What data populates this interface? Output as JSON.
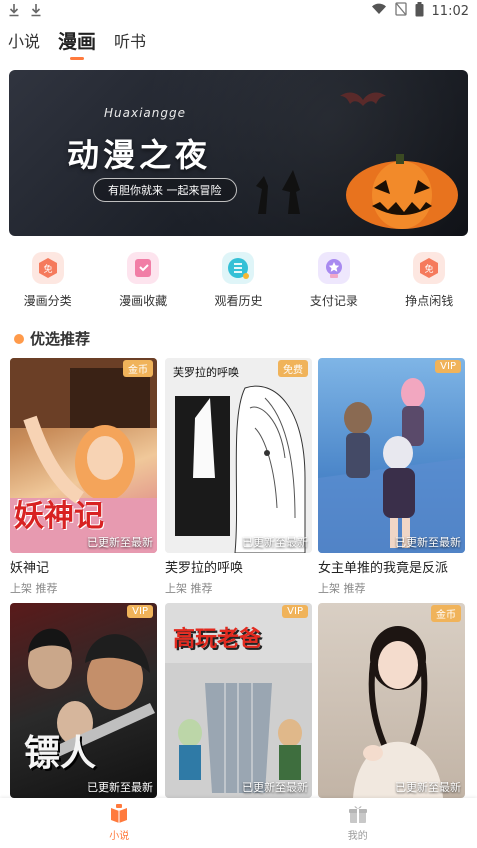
{
  "status_bar": {
    "time": "11:02"
  },
  "tabs": [
    {
      "label": "小说"
    },
    {
      "label": "漫画"
    },
    {
      "label": "听书"
    }
  ],
  "banner": {
    "brand": "Huaxiangge",
    "title": "动漫之夜",
    "subtitle": "有胆你就来 一起来冒险"
  },
  "quick_links": [
    {
      "label": "漫画分类",
      "icon": "free-badge-icon",
      "color": "#f57a5c"
    },
    {
      "label": "漫画收藏",
      "icon": "bookmark-icon",
      "color": "#f17ea6"
    },
    {
      "label": "观看历史",
      "icon": "history-list-icon",
      "color": "#34c0d6"
    },
    {
      "label": "支付记录",
      "icon": "medal-icon",
      "color": "#a88af0"
    },
    {
      "label": "挣点闲钱",
      "icon": "free-coin-icon",
      "color": "#f57a5c"
    }
  ],
  "section": {
    "title": "优选推荐"
  },
  "cards": [
    {
      "title": "妖神记",
      "tags": "上架 推荐",
      "badge": "金币",
      "update": "已更新至最新",
      "cover_text": "妖神记"
    },
    {
      "title": "芙罗拉的呼唤",
      "tags": "上架 推荐",
      "badge": "免费",
      "update": "已更新至最新",
      "cover_text": "芙罗拉的呼唤"
    },
    {
      "title": "女主单推的我竟是反派",
      "tags": "上架 推荐",
      "badge": "VIP",
      "update": "已更新至最新",
      "cover_text": ""
    },
    {
      "title": "",
      "tags": "",
      "badge": "VIP",
      "update": "已更新至最新",
      "cover_text": "镖人"
    },
    {
      "title": "",
      "tags": "",
      "badge": "VIP",
      "update": "已更新至最新",
      "cover_text": "高玩老爸"
    },
    {
      "title": "",
      "tags": "",
      "badge": "金币",
      "update": "已更新至最新",
      "cover_text": ""
    }
  ],
  "bottom_nav": [
    {
      "label": "小说",
      "icon": "book-icon"
    },
    {
      "label": "我的",
      "icon": "gift-icon"
    }
  ]
}
